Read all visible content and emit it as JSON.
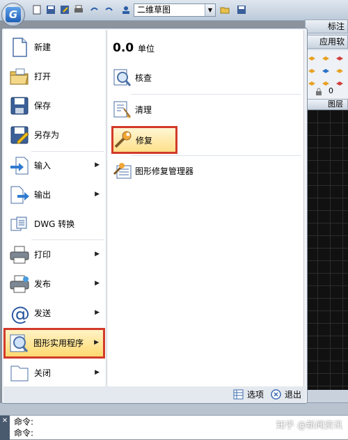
{
  "quick_access": {
    "workspace": "二维草图"
  },
  "right_panel": {
    "tab_annotate": "标注",
    "tab_apply": "应用软",
    "layer_value": "0",
    "layer_title": "图层"
  },
  "menu": {
    "left_items": [
      {
        "label": "新建",
        "icon": "new-file-icon"
      },
      {
        "label": "打开",
        "icon": "open-folder-icon"
      },
      {
        "label": "保存",
        "icon": "save-disk-icon"
      },
      {
        "label": "另存为",
        "icon": "save-as-icon"
      },
      {
        "label": "输入",
        "icon": "import-icon",
        "submenu": true
      },
      {
        "label": "输出",
        "icon": "export-icon",
        "submenu": true
      },
      {
        "label": "DWG 转换",
        "icon": "dwg-convert-icon"
      },
      {
        "label": "打印",
        "icon": "printer-icon",
        "submenu": true
      },
      {
        "label": "发布",
        "icon": "publish-icon",
        "submenu": true
      },
      {
        "label": "发送",
        "icon": "at-send-icon",
        "submenu": true
      },
      {
        "label": "图形实用程序",
        "icon": "drawing-utilities-icon",
        "submenu": true,
        "highlighted": true
      },
      {
        "label": "关闭",
        "icon": "close-folder-icon",
        "submenu": true
      }
    ],
    "right_items": [
      {
        "prefix": "0.0",
        "label": "单位"
      },
      {
        "label": "核查",
        "icon": "audit-icon"
      },
      {
        "label": "清理",
        "icon": "purge-icon"
      },
      {
        "label": "修复",
        "icon": "repair-wrench-icon",
        "highlighted": true
      },
      {
        "label": "图形修复管理器",
        "icon": "recovery-manager-icon"
      }
    ],
    "footer": {
      "options_label": "选项",
      "exit_label": "退出"
    }
  },
  "command_line": {
    "lines": [
      "命令:",
      "命令:"
    ],
    "side": "✕"
  },
  "watermark": "知乎 @新闻资讯",
  "colors": {
    "highlight_border": "#d23a2a",
    "highlight_fill": "#ffd970",
    "canvas": "#111111"
  }
}
